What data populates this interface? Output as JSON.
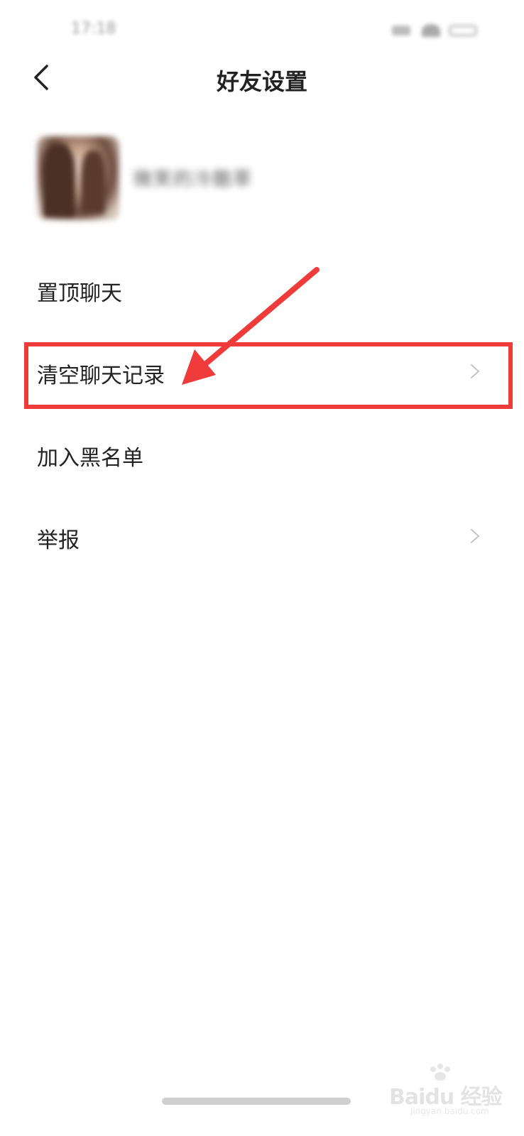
{
  "status_bar": {
    "time": "17:18"
  },
  "nav": {
    "title": "好友设置",
    "back_icon": "chevron-left-icon"
  },
  "profile": {
    "name": "微笑的冷酷草",
    "avatar_icon": "avatar"
  },
  "menu": {
    "items": [
      {
        "label": "置顶聊天",
        "control": "toggle"
      },
      {
        "label": "清空聊天记录",
        "control": "chevron"
      },
      {
        "label": "加入黑名单",
        "control": "none"
      },
      {
        "label": "举报",
        "control": "chevron"
      }
    ]
  },
  "annotation": {
    "highlight_color": "#f03b3b",
    "target": "清空聊天记录"
  },
  "watermark": {
    "text": "Baidu 经验",
    "sub": "jingyan.baidu.com"
  }
}
